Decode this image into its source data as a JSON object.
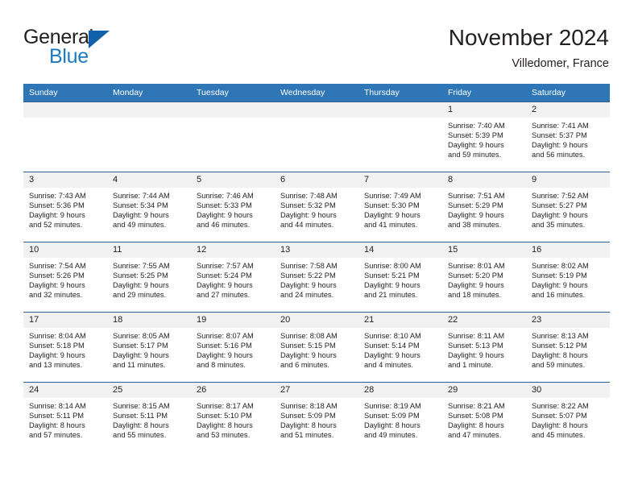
{
  "brand": {
    "name_part1": "General",
    "name_part2": "Blue",
    "triangle_icon": "triangle-icon",
    "accent_color": "#1b7ac1",
    "triangle_color": "#1161a8"
  },
  "header": {
    "title": "November 2024",
    "subtitle": "Villedomer, France"
  },
  "theme": {
    "header_row_bg": "#2f76b6",
    "header_row_text": "#ffffff",
    "daynum_bg": "#f1f1f1",
    "cell_border": "#2f5f8f",
    "text_color": "#231f20"
  },
  "weekday_headers": [
    "Sunday",
    "Monday",
    "Tuesday",
    "Wednesday",
    "Thursday",
    "Friday",
    "Saturday"
  ],
  "weeks": [
    [
      {
        "day": "",
        "blank": true,
        "lines": []
      },
      {
        "day": "",
        "blank": true,
        "lines": []
      },
      {
        "day": "",
        "blank": true,
        "lines": []
      },
      {
        "day": "",
        "blank": true,
        "lines": []
      },
      {
        "day": "",
        "blank": true,
        "lines": []
      },
      {
        "day": "1",
        "blank": false,
        "lines": [
          "Sunrise: 7:40 AM",
          "Sunset: 5:39 PM",
          "Daylight: 9 hours",
          "and 59 minutes."
        ]
      },
      {
        "day": "2",
        "blank": false,
        "lines": [
          "Sunrise: 7:41 AM",
          "Sunset: 5:37 PM",
          "Daylight: 9 hours",
          "and 56 minutes."
        ]
      }
    ],
    [
      {
        "day": "3",
        "blank": false,
        "lines": [
          "Sunrise: 7:43 AM",
          "Sunset: 5:36 PM",
          "Daylight: 9 hours",
          "and 52 minutes."
        ]
      },
      {
        "day": "4",
        "blank": false,
        "lines": [
          "Sunrise: 7:44 AM",
          "Sunset: 5:34 PM",
          "Daylight: 9 hours",
          "and 49 minutes."
        ]
      },
      {
        "day": "5",
        "blank": false,
        "lines": [
          "Sunrise: 7:46 AM",
          "Sunset: 5:33 PM",
          "Daylight: 9 hours",
          "and 46 minutes."
        ]
      },
      {
        "day": "6",
        "blank": false,
        "lines": [
          "Sunrise: 7:48 AM",
          "Sunset: 5:32 PM",
          "Daylight: 9 hours",
          "and 44 minutes."
        ]
      },
      {
        "day": "7",
        "blank": false,
        "lines": [
          "Sunrise: 7:49 AM",
          "Sunset: 5:30 PM",
          "Daylight: 9 hours",
          "and 41 minutes."
        ]
      },
      {
        "day": "8",
        "blank": false,
        "lines": [
          "Sunrise: 7:51 AM",
          "Sunset: 5:29 PM",
          "Daylight: 9 hours",
          "and 38 minutes."
        ]
      },
      {
        "day": "9",
        "blank": false,
        "lines": [
          "Sunrise: 7:52 AM",
          "Sunset: 5:27 PM",
          "Daylight: 9 hours",
          "and 35 minutes."
        ]
      }
    ],
    [
      {
        "day": "10",
        "blank": false,
        "lines": [
          "Sunrise: 7:54 AM",
          "Sunset: 5:26 PM",
          "Daylight: 9 hours",
          "and 32 minutes."
        ]
      },
      {
        "day": "11",
        "blank": false,
        "lines": [
          "Sunrise: 7:55 AM",
          "Sunset: 5:25 PM",
          "Daylight: 9 hours",
          "and 29 minutes."
        ]
      },
      {
        "day": "12",
        "blank": false,
        "lines": [
          "Sunrise: 7:57 AM",
          "Sunset: 5:24 PM",
          "Daylight: 9 hours",
          "and 27 minutes."
        ]
      },
      {
        "day": "13",
        "blank": false,
        "lines": [
          "Sunrise: 7:58 AM",
          "Sunset: 5:22 PM",
          "Daylight: 9 hours",
          "and 24 minutes."
        ]
      },
      {
        "day": "14",
        "blank": false,
        "lines": [
          "Sunrise: 8:00 AM",
          "Sunset: 5:21 PM",
          "Daylight: 9 hours",
          "and 21 minutes."
        ]
      },
      {
        "day": "15",
        "blank": false,
        "lines": [
          "Sunrise: 8:01 AM",
          "Sunset: 5:20 PM",
          "Daylight: 9 hours",
          "and 18 minutes."
        ]
      },
      {
        "day": "16",
        "blank": false,
        "lines": [
          "Sunrise: 8:02 AM",
          "Sunset: 5:19 PM",
          "Daylight: 9 hours",
          "and 16 minutes."
        ]
      }
    ],
    [
      {
        "day": "17",
        "blank": false,
        "lines": [
          "Sunrise: 8:04 AM",
          "Sunset: 5:18 PM",
          "Daylight: 9 hours",
          "and 13 minutes."
        ]
      },
      {
        "day": "18",
        "blank": false,
        "lines": [
          "Sunrise: 8:05 AM",
          "Sunset: 5:17 PM",
          "Daylight: 9 hours",
          "and 11 minutes."
        ]
      },
      {
        "day": "19",
        "blank": false,
        "lines": [
          "Sunrise: 8:07 AM",
          "Sunset: 5:16 PM",
          "Daylight: 9 hours",
          "and 8 minutes."
        ]
      },
      {
        "day": "20",
        "blank": false,
        "lines": [
          "Sunrise: 8:08 AM",
          "Sunset: 5:15 PM",
          "Daylight: 9 hours",
          "and 6 minutes."
        ]
      },
      {
        "day": "21",
        "blank": false,
        "lines": [
          "Sunrise: 8:10 AM",
          "Sunset: 5:14 PM",
          "Daylight: 9 hours",
          "and 4 minutes."
        ]
      },
      {
        "day": "22",
        "blank": false,
        "lines": [
          "Sunrise: 8:11 AM",
          "Sunset: 5:13 PM",
          "Daylight: 9 hours",
          "and 1 minute."
        ]
      },
      {
        "day": "23",
        "blank": false,
        "lines": [
          "Sunrise: 8:13 AM",
          "Sunset: 5:12 PM",
          "Daylight: 8 hours",
          "and 59 minutes."
        ]
      }
    ],
    [
      {
        "day": "24",
        "blank": false,
        "lines": [
          "Sunrise: 8:14 AM",
          "Sunset: 5:11 PM",
          "Daylight: 8 hours",
          "and 57 minutes."
        ]
      },
      {
        "day": "25",
        "blank": false,
        "lines": [
          "Sunrise: 8:15 AM",
          "Sunset: 5:11 PM",
          "Daylight: 8 hours",
          "and 55 minutes."
        ]
      },
      {
        "day": "26",
        "blank": false,
        "lines": [
          "Sunrise: 8:17 AM",
          "Sunset: 5:10 PM",
          "Daylight: 8 hours",
          "and 53 minutes."
        ]
      },
      {
        "day": "27",
        "blank": false,
        "lines": [
          "Sunrise: 8:18 AM",
          "Sunset: 5:09 PM",
          "Daylight: 8 hours",
          "and 51 minutes."
        ]
      },
      {
        "day": "28",
        "blank": false,
        "lines": [
          "Sunrise: 8:19 AM",
          "Sunset: 5:09 PM",
          "Daylight: 8 hours",
          "and 49 minutes."
        ]
      },
      {
        "day": "29",
        "blank": false,
        "lines": [
          "Sunrise: 8:21 AM",
          "Sunset: 5:08 PM",
          "Daylight: 8 hours",
          "and 47 minutes."
        ]
      },
      {
        "day": "30",
        "blank": false,
        "lines": [
          "Sunrise: 8:22 AM",
          "Sunset: 5:07 PM",
          "Daylight: 8 hours",
          "and 45 minutes."
        ]
      }
    ]
  ]
}
